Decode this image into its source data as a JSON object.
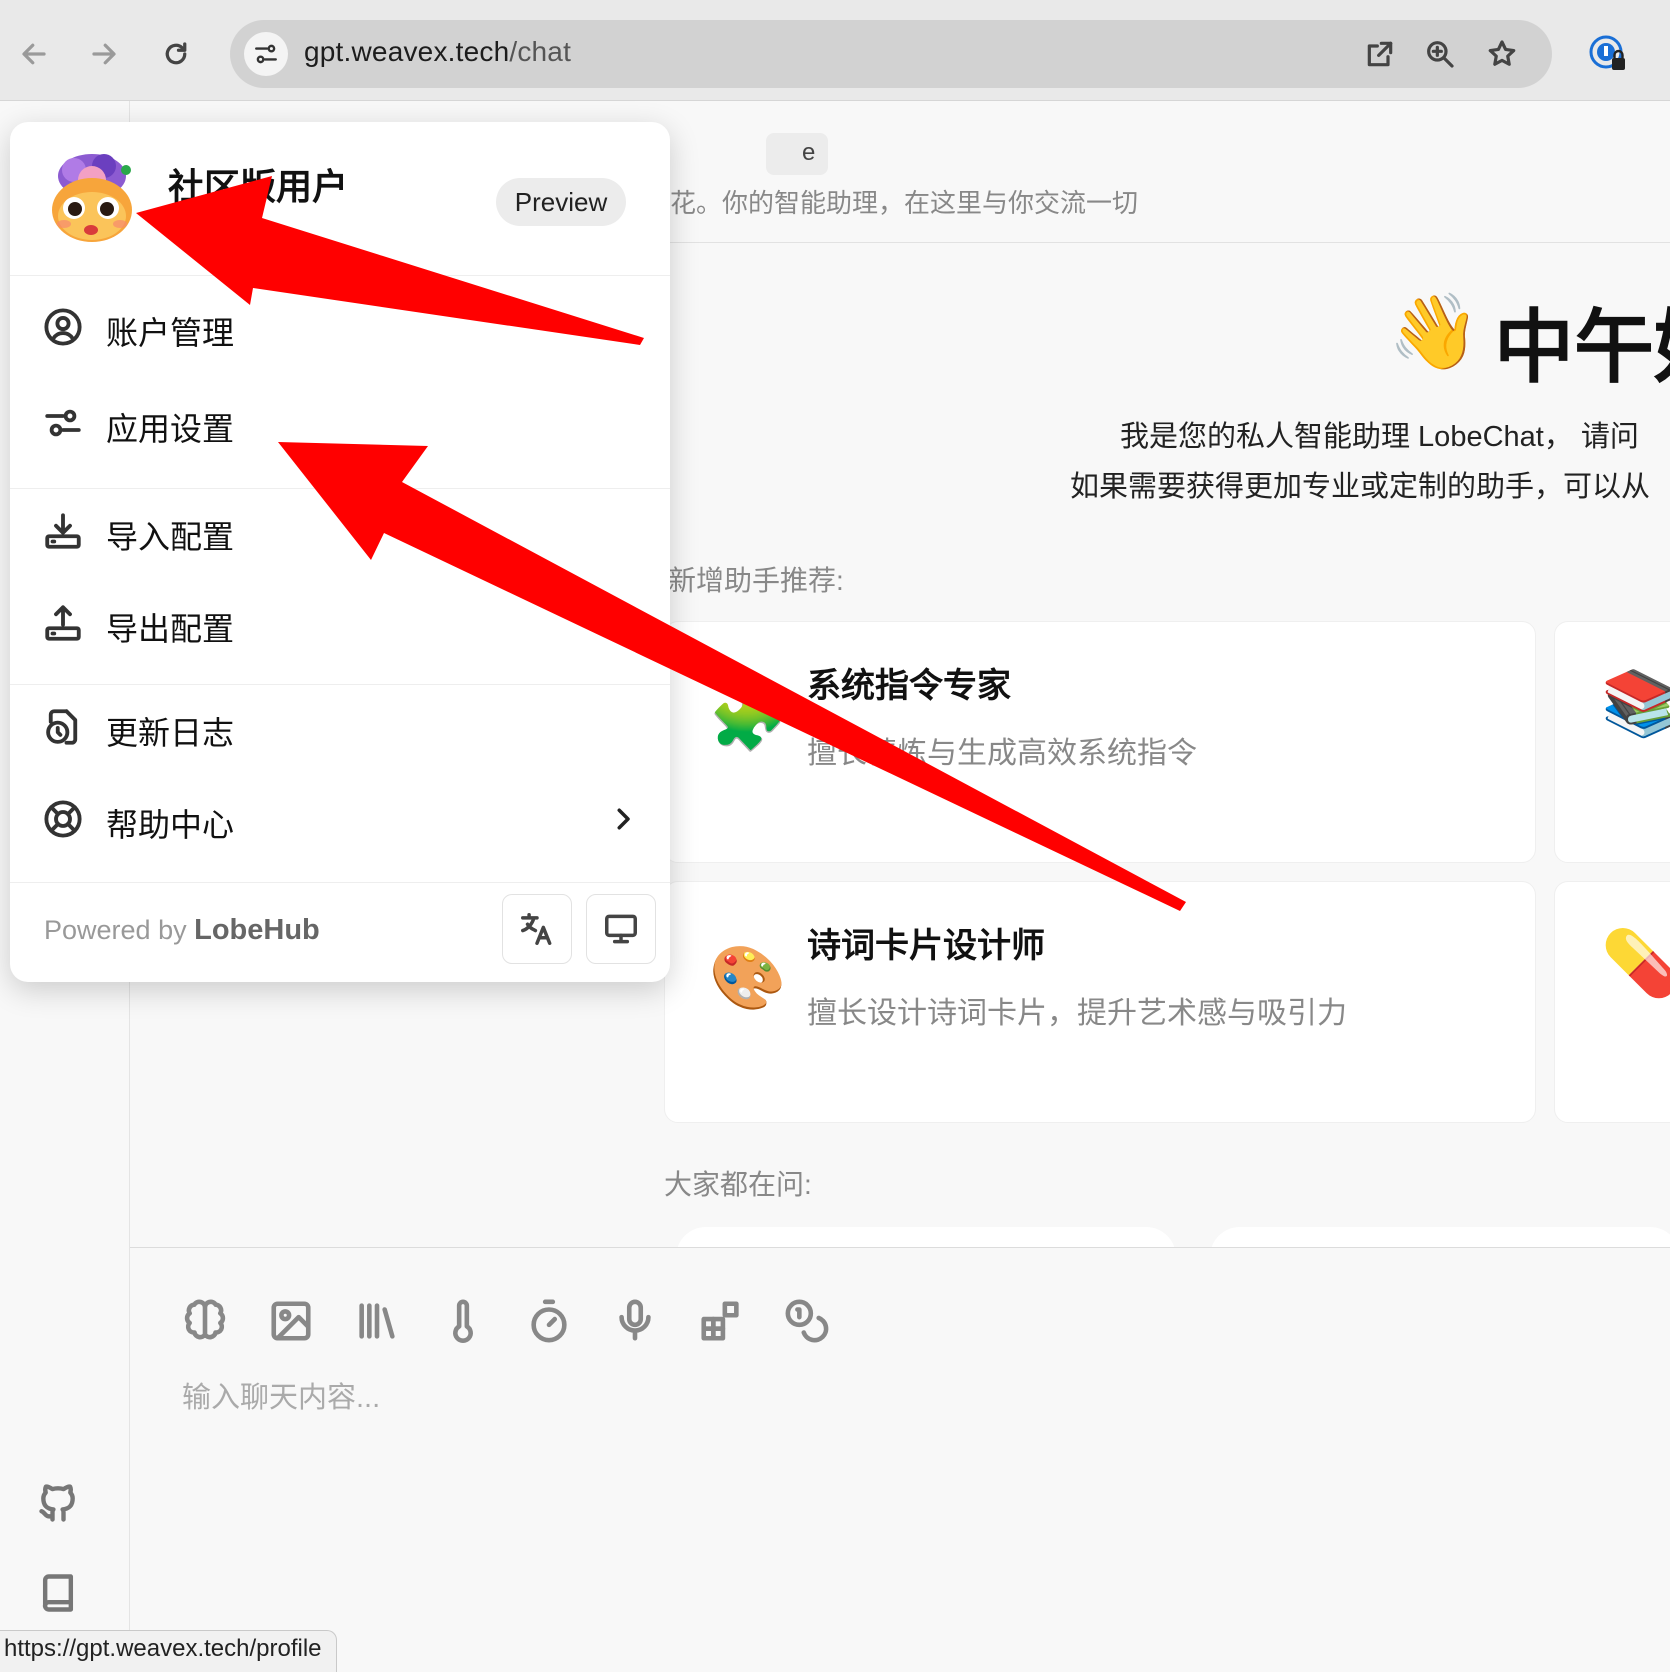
{
  "browser": {
    "url_host": "gpt.weavex.tech",
    "url_path": "/chat",
    "status_url": "https://gpt.weavex.tech/profile"
  },
  "chat_header": {
    "title_fragment": "e",
    "description": "花。你的智能助理，在这里与你交流一切"
  },
  "welcome": {
    "emoji": "👋",
    "title": "中午好",
    "intro_line1": "我是您的私人智能助理 LobeChat， 请问",
    "intro_line2": "如果需要获得更加专业或定制的助手，可以从"
  },
  "recommend": {
    "label": "新增助手推荐:",
    "cards": [
      {
        "emoji": "🧩",
        "title": "系统指令专家",
        "desc": "擅长精炼与生成高效系统指令"
      },
      {
        "emoji": "🎨",
        "title": "诗词卡片设计师",
        "desc": "擅长设计诗词卡片，提升艺术感与吸引力"
      }
    ],
    "peek_emojis": [
      "📚",
      "💊"
    ]
  },
  "faq": {
    "label": "大家都在问:"
  },
  "input": {
    "placeholder": "输入聊天内容...",
    "tools": [
      "brain-icon",
      "image-icon",
      "library-icon",
      "thermometer-icon",
      "timer-icon",
      "microphone-icon",
      "plugin-icon",
      "token-icon"
    ]
  },
  "menu": {
    "user_name": "社区版用户",
    "user_sub": "LobeChat",
    "badge": "Preview",
    "items": [
      {
        "label": "账户管理",
        "icon": "user-circle-icon"
      },
      {
        "label": "应用设置",
        "icon": "settings-sliders-icon"
      },
      {
        "label": "导入配置",
        "icon": "import-icon"
      },
      {
        "label": "导出配置",
        "icon": "export-icon"
      },
      {
        "label": "更新日志",
        "icon": "changelog-icon"
      },
      {
        "label": "帮助中心",
        "icon": "lifebuoy-icon"
      }
    ],
    "powered_by": "Powered by",
    "powered_brand": "LobeHub"
  },
  "colors": {
    "arrow": "#ff0000",
    "accent": "#111111"
  }
}
